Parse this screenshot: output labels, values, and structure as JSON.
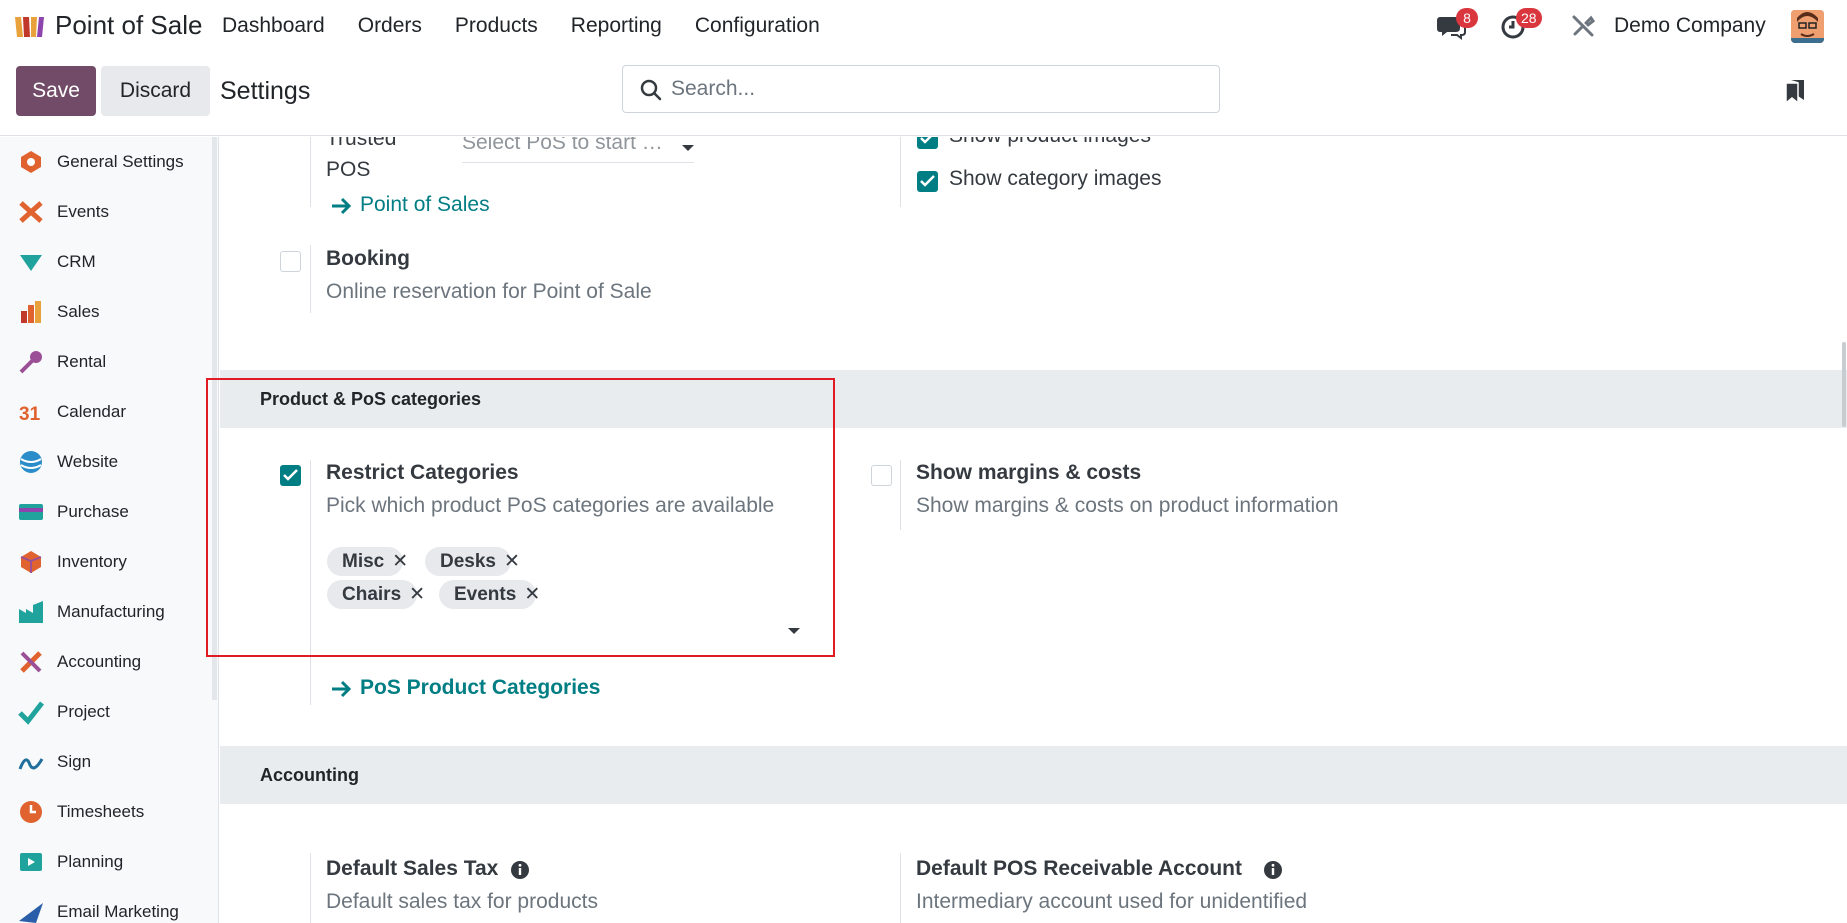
{
  "navbar": {
    "app_name": "Point of Sale",
    "menu": [
      "Dashboard",
      "Orders",
      "Products",
      "Reporting",
      "Configuration"
    ],
    "messages_badge": "8",
    "activities_badge": "28",
    "company": "Demo Company"
  },
  "control": {
    "save_label": "Save",
    "discard_label": "Discard",
    "title": "Settings",
    "search_placeholder": "Search..."
  },
  "sidebar": {
    "items": [
      {
        "label": "General Settings",
        "icon": "general-settings-icon",
        "color": "#e0622f"
      },
      {
        "label": "Events",
        "icon": "events-icon",
        "color": "#e0622f"
      },
      {
        "label": "CRM",
        "icon": "crm-icon",
        "color": "#1fa39c"
      },
      {
        "label": "Sales",
        "icon": "sales-icon",
        "color": "#e0622f"
      },
      {
        "label": "Rental",
        "icon": "rental-icon",
        "color": "#9b4f96"
      },
      {
        "label": "Calendar",
        "icon": "calendar-icon",
        "color": "#e0622f"
      },
      {
        "label": "Website",
        "icon": "website-icon",
        "color": "#2a8cc8"
      },
      {
        "label": "Purchase",
        "icon": "purchase-icon",
        "color": "#1fa39c"
      },
      {
        "label": "Inventory",
        "icon": "inventory-icon",
        "color": "#e0622f"
      },
      {
        "label": "Manufacturing",
        "icon": "manufacturing-icon",
        "color": "#1fa39c"
      },
      {
        "label": "Accounting",
        "icon": "accounting-icon",
        "color": "#e0622f"
      },
      {
        "label": "Project",
        "icon": "project-icon",
        "color": "#1fa39c"
      },
      {
        "label": "Sign",
        "icon": "sign-icon",
        "color": "#1f6e9c"
      },
      {
        "label": "Timesheets",
        "icon": "timesheets-icon",
        "color": "#e0622f"
      },
      {
        "label": "Planning",
        "icon": "planning-icon",
        "color": "#1fa39c"
      },
      {
        "label": "Email Marketing",
        "icon": "email-marketing-icon",
        "color": "#2a5ea8"
      }
    ]
  },
  "content": {
    "trusted_pos_label_1": "Trusted",
    "trusted_pos_label_2": "POS",
    "trusted_pos_placeholder": "Select PoS to start …",
    "point_of_sales_link": "Point of Sales",
    "show_product_images": "Show product images",
    "show_category_images": "Show category images",
    "booking_title": "Booking",
    "booking_desc": "Online reservation for Point of Sale",
    "section_categories": "Product & PoS categories",
    "restrict_title": "Restrict Categories",
    "restrict_desc": "Pick which product PoS categories are available",
    "tags": [
      "Misc",
      "Desks",
      "Chairs",
      "Events"
    ],
    "pos_product_categories_link": "PoS Product Categories",
    "margins_title": "Show margins & costs",
    "margins_desc": "Show margins & costs on product information",
    "section_accounting": "Accounting",
    "default_tax_title": "Default Sales Tax",
    "default_tax_desc": "Default sales tax for products",
    "receivable_title": "Default POS Receivable Account",
    "receivable_desc": "Intermediary account used for unidentified"
  },
  "colors": {
    "brand": "#714b67",
    "accent": "#017e84",
    "badge": "#d9363e",
    "highlight": "#e01b24"
  }
}
